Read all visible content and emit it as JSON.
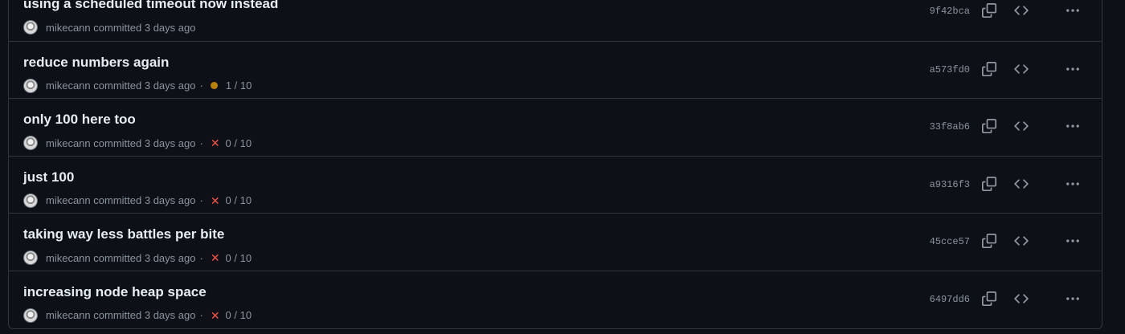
{
  "commits": [
    {
      "title": "using a scheduled timeout now instead",
      "author": "mikecann",
      "verb": "committed",
      "time": "3 days ago",
      "status": "none",
      "checks": "",
      "sha": "9f42bca"
    },
    {
      "title": "reduce numbers again",
      "author": "mikecann",
      "verb": "committed",
      "time": "3 days ago",
      "status": "pending",
      "checks": "1 / 10",
      "sha": "a573fd0"
    },
    {
      "title": "only 100 here too",
      "author": "mikecann",
      "verb": "committed",
      "time": "3 days ago",
      "status": "failed",
      "checks": "0 / 10",
      "sha": "33f8ab6"
    },
    {
      "title": "just 100",
      "author": "mikecann",
      "verb": "committed",
      "time": "3 days ago",
      "status": "failed",
      "checks": "0 / 10",
      "sha": "a9316f3"
    },
    {
      "title": "taking way less battles per bite",
      "author": "mikecann",
      "verb": "committed",
      "time": "3 days ago",
      "status": "failed",
      "checks": "0 / 10",
      "sha": "45cce57"
    },
    {
      "title": "increasing node heap space",
      "author": "mikecann",
      "verb": "committed",
      "time": "3 days ago",
      "status": "failed",
      "checks": "0 / 10",
      "sha": "6497dd6"
    }
  ],
  "separator": "·",
  "icons": {
    "copy": "copy-icon",
    "browse": "code-icon",
    "more": "kebab-horizontal-icon",
    "pending": "dot-fill-icon",
    "failed": "x-icon"
  },
  "colors": {
    "background": "#0d1117",
    "border": "#30363d",
    "pending": "#bb8009",
    "failed": "#f85149",
    "muted": "#8b949e"
  }
}
